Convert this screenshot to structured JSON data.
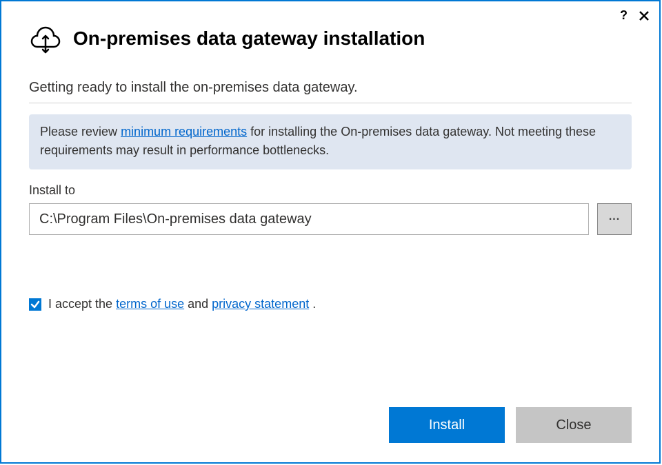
{
  "header": {
    "title": "On-premises data gateway installation"
  },
  "subtitle": "Getting ready to install the on-premises data gateway.",
  "info": {
    "text_before": "Please review ",
    "link": "minimum requirements",
    "text_after": " for installing the On-premises data gateway. Not meeting these requirements may result in performance bottlenecks."
  },
  "install": {
    "label": "Install to",
    "value": "C:\\Program Files\\On-premises data gateway",
    "browse_label": "..."
  },
  "accept": {
    "checked": true,
    "text_before": "I accept the ",
    "terms_link": "terms of use",
    "text_mid": " and ",
    "privacy_link": "privacy statement",
    "text_after": " ."
  },
  "buttons": {
    "primary": "Install",
    "secondary": "Close"
  },
  "titlebar": {
    "help": "?"
  }
}
